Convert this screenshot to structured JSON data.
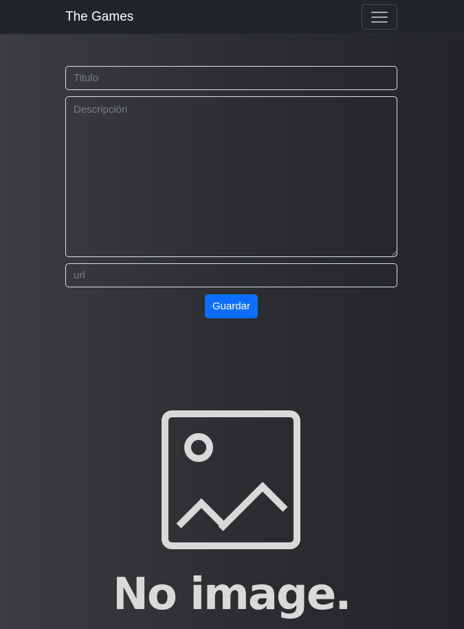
{
  "navbar": {
    "brand": "The Games",
    "toggler_icon": "hamburger-menu-icon"
  },
  "form": {
    "title_placeholder": "Titulo",
    "description_placeholder": "Descripción",
    "url_placeholder": "url",
    "save_label": "Guardar"
  },
  "preview": {
    "placeholder_icon": "image-placeholder-icon",
    "placeholder_text": "No image.",
    "color": "#d9d9d9"
  },
  "colors": {
    "navbar_bg": "#212529",
    "primary": "#0d6efd",
    "border": "#dee2e6"
  }
}
